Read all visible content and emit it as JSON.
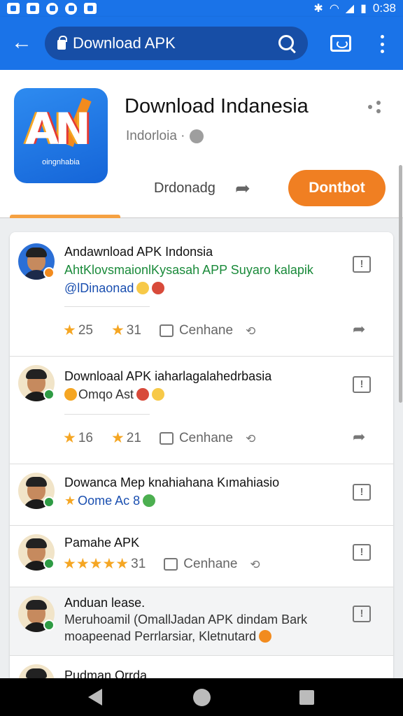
{
  "status_bar": {
    "time": "0:38"
  },
  "app_bar": {
    "search_text": "Download APK"
  },
  "app": {
    "title": "Download Indanesia",
    "icon_text": "AN",
    "icon_subtext": "oingnhabia",
    "developer": "Indorloia ·",
    "secondary_action": "Drdonadg",
    "install_label": "Dontbot"
  },
  "posts": [
    {
      "title": "Andawnload APK Indonsia",
      "line1": "AhtKlovsmaionlKysasah APP Suyaro kalapik",
      "line2": "@lDinaonad",
      "likes": "25",
      "stars": "31",
      "comment_label": "Cenhane"
    },
    {
      "title": "Downloaal APK iaharlagalahedrbasia",
      "line1": "Omqo  Ast",
      "likes": "16",
      "stars": "21",
      "comment_label": "Cenhane"
    },
    {
      "title": "Dowanca Mep knahiahana Kımahiasio",
      "line1": "Oome  Ac 8"
    },
    {
      "title": "Pamahe APK",
      "stars": "31",
      "comment_label": "Cenhane"
    },
    {
      "title": "Anduan lease.",
      "line1": "Meruhoamil (OmallJadan APK dindam Bark",
      "line2": "moapeenad  Perrlarsiar, Kletnutard"
    },
    {
      "title": "Pudman  Orrda"
    }
  ],
  "colors": {
    "primary": "#1a73e8",
    "install": "#f07f22",
    "star": "#f5a623"
  }
}
